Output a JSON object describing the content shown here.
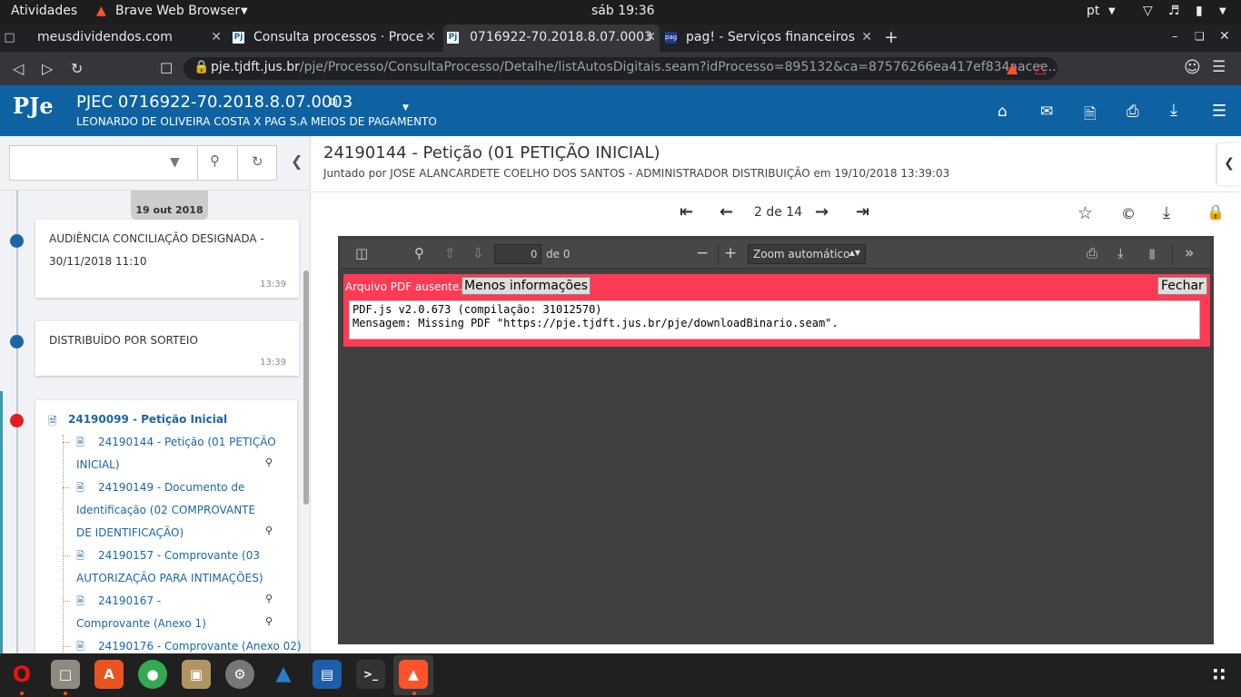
{
  "system": {
    "activities": "Atividades",
    "app_name": "Brave Web Browser",
    "clock": "sáb 19:36",
    "lang": "pt"
  },
  "tabs": [
    {
      "title": "meusdividendos.com",
      "favicon": "M"
    },
    {
      "title": "Consulta processos · Proce",
      "favicon": "Pj"
    },
    {
      "title": "0716922-70.2018.8.07.0003",
      "favicon": "Pj"
    },
    {
      "title": "pag! - Serviços financeiros",
      "favicon": "pag"
    }
  ],
  "address": {
    "host": "pje.tjdft.jus.br",
    "path": "/pje/Processo/ConsultaProcesso/Detalhe/listAutosDigitais.seam?idProcesso=895132&ca=87576266ea417ef834aacee…"
  },
  "pje": {
    "logo": "PJe",
    "process_title": "PJEC 0716922-70.2018.8.07.0003",
    "parties": "LEONARDO DE OLIVEIRA COSTA X PAG S.A MEIOS DE PAGAMENTO"
  },
  "sidebar": {
    "date_badge": "19 out 2018",
    "events": [
      {
        "text": "AUDIÊNCIA CONCILIAÇÃO DESIGNADA - 30/11/2018 11:10",
        "time": "13:39"
      },
      {
        "text": "DISTRIBUÍDO POR SORTEIO",
        "time": "13:39"
      }
    ],
    "doc_group_title": "24190099 - Petição Inicial",
    "docs": [
      "24190144 - Petição (01 PETIÇÃO INICIAL)",
      "24190149 - Documento de Identificação (02 COMPROVANTE DE IDENTIFICAÇÃO)",
      "24190157 - Comprovante (03 AUTORIZAÇÃO PARA INTIMAÇÕES)",
      "24190167 - Comprovante (Anexo 1)",
      "24190176 - Comprovante (Anexo 02)"
    ]
  },
  "document": {
    "title": "24190144 - Petição (01 PETIÇÃO INICIAL)",
    "joined_by": "Juntado por JOSE ALANCARDETE COELHO DOS SANTOS - ADMINISTRADOR DISTRIBUIÇÃO em 19/10/2018 13:39:03",
    "page_indicator": "2 de 14"
  },
  "pdf": {
    "page_value": "0",
    "page_of": "de 0",
    "zoom": "Zoom automático",
    "error_text": "Arquivo PDF ausente.",
    "less_info": "Menos informações",
    "close": "Fechar",
    "message": "PDF.js v2.0.673 (compilação: 31012570)\nMensagem: Missing PDF \"https://pje.tjdft.jus.br/pje/downloadBinario.seam\"."
  },
  "colors": {
    "pje_blue": "#0e62a2",
    "error_red": "#ff3a55",
    "link_blue": "#1c65a7"
  }
}
